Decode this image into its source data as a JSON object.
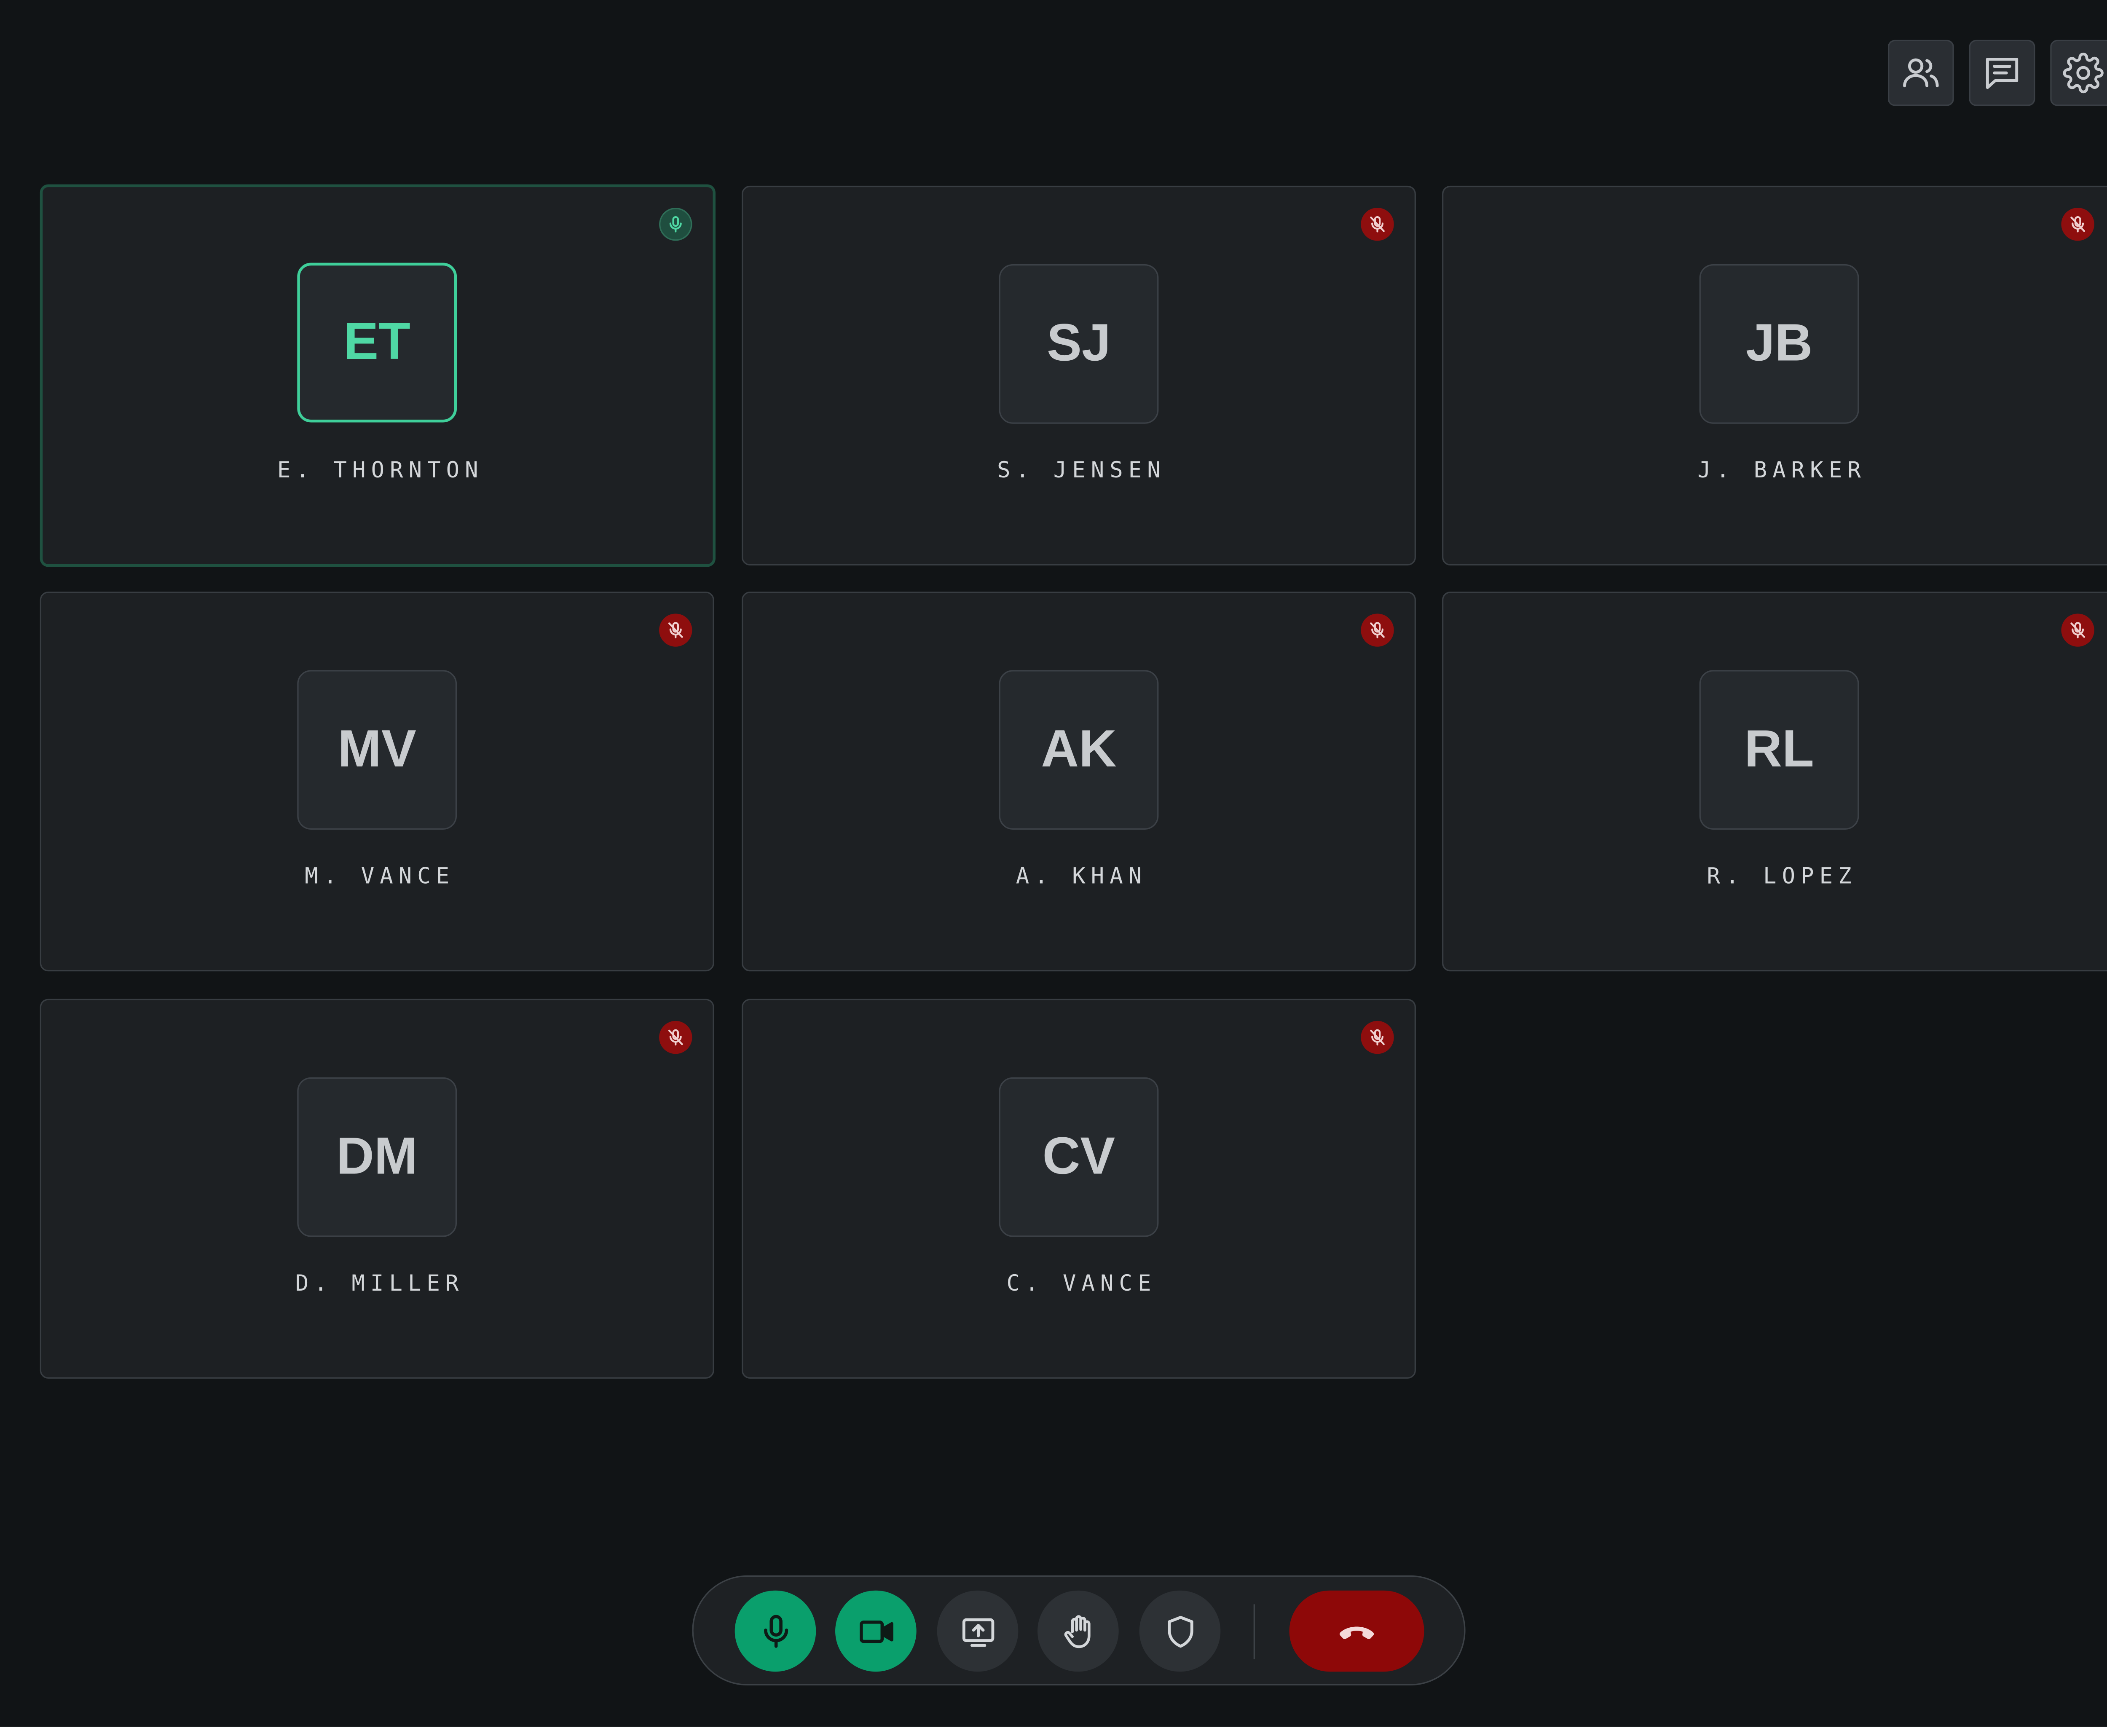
{
  "header_actions": [
    {
      "icon": "participants-icon",
      "name": "participants-button"
    },
    {
      "icon": "chat-icon",
      "name": "chat-button"
    },
    {
      "icon": "gear-icon",
      "name": "settings-button"
    }
  ],
  "participants": [
    {
      "initials": "ET",
      "name": "E. THORNTON",
      "speaking": true,
      "mic": "on"
    },
    {
      "initials": "SJ",
      "name": "S. JENSEN",
      "speaking": false,
      "mic": "muted"
    },
    {
      "initials": "JB",
      "name": "J. BARKER",
      "speaking": false,
      "mic": "muted"
    },
    {
      "initials": "MV",
      "name": "M. VANCE",
      "speaking": false,
      "mic": "muted"
    },
    {
      "initials": "AK",
      "name": "A. KHAN",
      "speaking": false,
      "mic": "muted"
    },
    {
      "initials": "RL",
      "name": "R. LOPEZ",
      "speaking": false,
      "mic": "muted"
    },
    {
      "initials": "DM",
      "name": "D. MILLER",
      "speaking": false,
      "mic": "muted"
    },
    {
      "initials": "CV",
      "name": "C. VANCE",
      "speaking": false,
      "mic": "muted"
    }
  ],
  "controls": [
    {
      "icon": "microphone-icon",
      "name": "microphone-toggle-button",
      "state": "on"
    },
    {
      "icon": "video-camera-icon",
      "name": "camera-toggle-button",
      "state": "on"
    },
    {
      "icon": "share-screen-icon",
      "name": "share-screen-button",
      "state": "off"
    },
    {
      "icon": "raise-hand-icon",
      "name": "raise-hand-button",
      "state": "off"
    },
    {
      "icon": "shield-icon",
      "name": "security-button",
      "state": "off"
    },
    {
      "icon": "hang-up-icon",
      "name": "end-call-button",
      "state": "danger"
    }
  ],
  "colors": {
    "background": "#111416",
    "tile": "#1d2023",
    "accent_green": "#0a9f6c",
    "speaking_highlight": "#3fcf9a",
    "muted_red": "#8e0e0e",
    "end_call_red": "#8e0808"
  }
}
